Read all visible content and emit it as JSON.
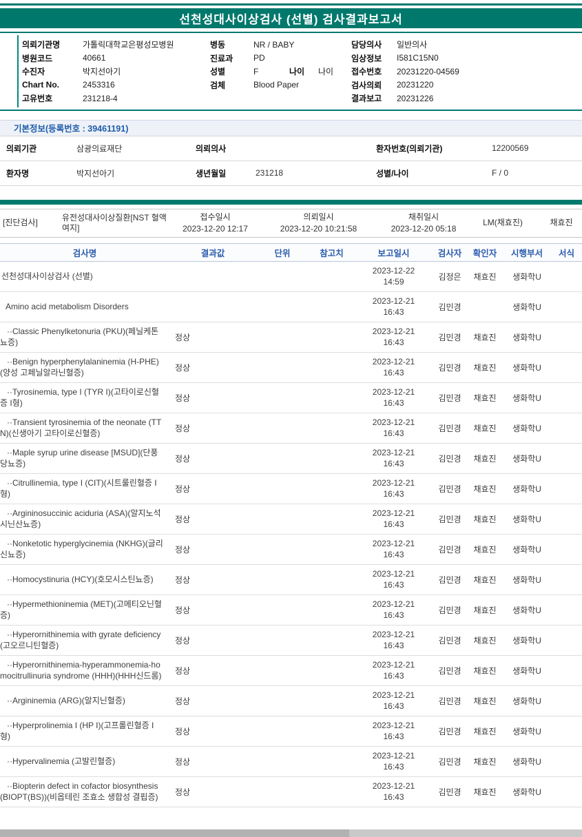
{
  "report": {
    "title": "선천성대사이상검사 (선별) 검사결과보고서"
  },
  "colors": {
    "accent_teal": "#00796e",
    "header_blue": "#2b5cad",
    "section_title_blue": "#1f5ca9"
  },
  "patient_header": {
    "col1": [
      {
        "label": "의뢰기관명",
        "value": "가톨릭대학교은평성모병원"
      },
      {
        "label": "병원코드",
        "value": "40661"
      },
      {
        "label": "수진자",
        "value": "박지선아기"
      },
      {
        "label": "Chart No.",
        "value": "2453316"
      },
      {
        "label": "고유번호",
        "value": "231218-4"
      }
    ],
    "col2": [
      {
        "label": "병동",
        "value": "NR / BABY"
      },
      {
        "label": "진료과",
        "value": "PD"
      },
      {
        "label": "성별",
        "value": "F",
        "label2": "나이",
        "value2": "나이"
      },
      {
        "label": "검체",
        "value": "Blood Paper"
      }
    ],
    "col3": [
      {
        "label": "담당의사",
        "value": "일반의사"
      },
      {
        "label": "임상정보",
        "value": "I581C15N0"
      },
      {
        "label": "접수번호",
        "value": "20231220-04569"
      },
      {
        "label": "검사의뢰",
        "value": "20231220"
      },
      {
        "label": "결과보고",
        "value": "20231226"
      }
    ]
  },
  "basic_info": {
    "title": "기본정보(등록번호 : 39461191)",
    "rows": [
      {
        "cells": [
          {
            "label": "의뢰기관",
            "value": "삼광의료재단"
          },
          {
            "label": "의뢰의사",
            "value": ""
          },
          {
            "label": "환자번호(의뢰기관)",
            "value": "12200569"
          }
        ]
      },
      {
        "cells": [
          {
            "label": "환자명",
            "value": "박지선아기"
          },
          {
            "label": "생년월일",
            "value": "231218"
          },
          {
            "label": "성별/나이",
            "value": "F / 0"
          }
        ]
      }
    ]
  },
  "order": {
    "category": "[진단검사]",
    "test_name": "유전성대사이상질환[NST 혈액 여지]",
    "receipt": {
      "label": "접수일시",
      "value": "2023-12-20 12:17"
    },
    "request": {
      "label": "의뢰일시",
      "value": "2023-12-20 10:21:58"
    },
    "collection": {
      "label": "채취일시",
      "value": "2023-12-20 05:18"
    },
    "lm": "LM(채효진)",
    "collector": "채효진"
  },
  "results": {
    "columns": [
      "검사명",
      "결과값",
      "단위",
      "참고치",
      "보고일시",
      "검사자",
      "확인자",
      "시행부서",
      "서식"
    ],
    "rows": [
      {
        "name": "선천성대사이상검사 (선별)",
        "level": 0,
        "result": "",
        "date": "2023-12-22",
        "time": "14:59",
        "examiner": "김정은",
        "confirmer": "채효진",
        "dept": "생화학U"
      },
      {
        "name": "Amino acid metabolism Disorders",
        "level": 1,
        "result": "",
        "date": "2023-12-21",
        "time": "16:43",
        "examiner": "김민경",
        "confirmer": "",
        "dept": "생화학U"
      },
      {
        "name": "··Classic Phenylketonuria (PKU)(페닐케톤뇨증)",
        "level": 2,
        "result": "정상",
        "date": "2023-12-21",
        "time": "16:43",
        "examiner": "김민경",
        "confirmer": "채효진",
        "dept": "생화학U"
      },
      {
        "name": "··Benign hyperphenylalaninemia (H-PHE)(양성 고페닐알라닌혈증)",
        "level": 2,
        "result": "정상",
        "date": "2023-12-21",
        "time": "16:43",
        "examiner": "김민경",
        "confirmer": "채효진",
        "dept": "생화학U"
      },
      {
        "name": "··Tyrosinemia, type I (TYR I)(고타이로신혈증 I형)",
        "level": 2,
        "result": "정상",
        "date": "2023-12-21",
        "time": "16:43",
        "examiner": "김민경",
        "confirmer": "채효진",
        "dept": "생화학U"
      },
      {
        "name": "··Transient tyrosinemia of the neonate (TTN)(신생아기 고타이로신혈증)",
        "level": 2,
        "result": "정상",
        "date": "2023-12-21",
        "time": "16:43",
        "examiner": "김민경",
        "confirmer": "채효진",
        "dept": "생화학U"
      },
      {
        "name": "··Maple syrup urine disease [MSUD](단풍당뇨증)",
        "level": 2,
        "result": "정상",
        "date": "2023-12-21",
        "time": "16:43",
        "examiner": "김민경",
        "confirmer": "채효진",
        "dept": "생화학U"
      },
      {
        "name": "··Citrullinemia, type I (CIT)(시트룰린혈증 I형)",
        "level": 2,
        "result": "정상",
        "date": "2023-12-21",
        "time": "16:43",
        "examiner": "김민경",
        "confirmer": "채효진",
        "dept": "생화학U"
      },
      {
        "name": "··Argininosuccinic aciduria (ASA)(알지노석시닌산뇨증)",
        "level": 2,
        "result": "정상",
        "date": "2023-12-21",
        "time": "16:43",
        "examiner": "김민경",
        "confirmer": "채효진",
        "dept": "생화학U"
      },
      {
        "name": "··Nonketotic hyperglycinemia (NKHG)(글리신뇨증)",
        "level": 2,
        "result": "정상",
        "date": "2023-12-21",
        "time": "16:43",
        "examiner": "김민경",
        "confirmer": "채효진",
        "dept": "생화학U"
      },
      {
        "name": "··Homocystinuria (HCY)(호모시스틴뇨증)",
        "level": 2,
        "result": "정상",
        "date": "2023-12-21",
        "time": "16:43",
        "examiner": "김민경",
        "confirmer": "채효진",
        "dept": "생화학U"
      },
      {
        "name": "··Hypermethioninemia (MET)(고메티오닌혈증)",
        "level": 2,
        "result": "정상",
        "date": "2023-12-21",
        "time": "16:43",
        "examiner": "김민경",
        "confirmer": "채효진",
        "dept": "생화학U"
      },
      {
        "name": "··Hyperornithinemia with gyrate deficiency(고오르니틴혈증)",
        "level": 2,
        "result": "정상",
        "date": "2023-12-21",
        "time": "16:43",
        "examiner": "김민경",
        "confirmer": "채효진",
        "dept": "생화학U"
      },
      {
        "name": "··Hyperornithinemia-hyperammonemia-homocitrullinuria syndrome (HHH)(HHH신드롬)",
        "level": 2,
        "result": "정상",
        "date": "2023-12-21",
        "time": "16:43",
        "examiner": "김민경",
        "confirmer": "채효진",
        "dept": "생화학U"
      },
      {
        "name": "··Argininemia (ARG)(알지닌혈증)",
        "level": 2,
        "result": "정상",
        "date": "2023-12-21",
        "time": "16:43",
        "examiner": "김민경",
        "confirmer": "채효진",
        "dept": "생화학U"
      },
      {
        "name": "··Hyperprolinemia I (HP I)(고프롤린혈증 I형)",
        "level": 2,
        "result": "정상",
        "date": "2023-12-21",
        "time": "16:43",
        "examiner": "김민경",
        "confirmer": "채효진",
        "dept": "생화학U"
      },
      {
        "name": "··Hypervalinemia (고발린혈증)",
        "level": 2,
        "result": "정상",
        "date": "2023-12-21",
        "time": "16:43",
        "examiner": "김민경",
        "confirmer": "채효진",
        "dept": "생화학U"
      },
      {
        "name": "··Biopterin defect in cofactor biosynthesis (BIOPT(BS))(비옵테린 조효소 생합성 결핍증)",
        "level": 2,
        "result": "정상",
        "date": "2023-12-21",
        "time": "16:43",
        "examiner": "김민경",
        "confirmer": "채효진",
        "dept": "생화학U"
      }
    ]
  }
}
